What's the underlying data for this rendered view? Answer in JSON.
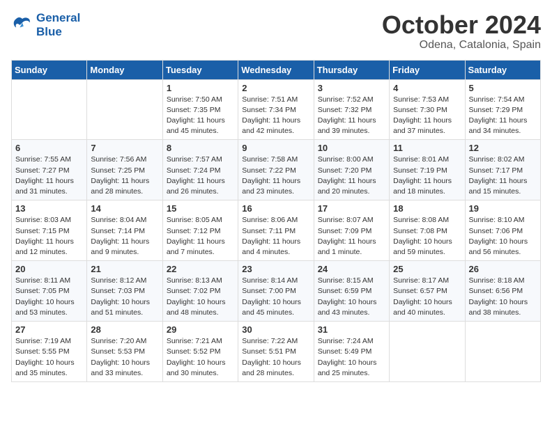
{
  "header": {
    "logo_line1": "General",
    "logo_line2": "Blue",
    "month": "October 2024",
    "location": "Odena, Catalonia, Spain"
  },
  "weekdays": [
    "Sunday",
    "Monday",
    "Tuesday",
    "Wednesday",
    "Thursday",
    "Friday",
    "Saturday"
  ],
  "weeks": [
    [
      {
        "day": null
      },
      {
        "day": null
      },
      {
        "day": 1,
        "sunrise": "Sunrise: 7:50 AM",
        "sunset": "Sunset: 7:35 PM",
        "daylight": "Daylight: 11 hours and 45 minutes."
      },
      {
        "day": 2,
        "sunrise": "Sunrise: 7:51 AM",
        "sunset": "Sunset: 7:34 PM",
        "daylight": "Daylight: 11 hours and 42 minutes."
      },
      {
        "day": 3,
        "sunrise": "Sunrise: 7:52 AM",
        "sunset": "Sunset: 7:32 PM",
        "daylight": "Daylight: 11 hours and 39 minutes."
      },
      {
        "day": 4,
        "sunrise": "Sunrise: 7:53 AM",
        "sunset": "Sunset: 7:30 PM",
        "daylight": "Daylight: 11 hours and 37 minutes."
      },
      {
        "day": 5,
        "sunrise": "Sunrise: 7:54 AM",
        "sunset": "Sunset: 7:29 PM",
        "daylight": "Daylight: 11 hours and 34 minutes."
      }
    ],
    [
      {
        "day": 6,
        "sunrise": "Sunrise: 7:55 AM",
        "sunset": "Sunset: 7:27 PM",
        "daylight": "Daylight: 11 hours and 31 minutes."
      },
      {
        "day": 7,
        "sunrise": "Sunrise: 7:56 AM",
        "sunset": "Sunset: 7:25 PM",
        "daylight": "Daylight: 11 hours and 28 minutes."
      },
      {
        "day": 8,
        "sunrise": "Sunrise: 7:57 AM",
        "sunset": "Sunset: 7:24 PM",
        "daylight": "Daylight: 11 hours and 26 minutes."
      },
      {
        "day": 9,
        "sunrise": "Sunrise: 7:58 AM",
        "sunset": "Sunset: 7:22 PM",
        "daylight": "Daylight: 11 hours and 23 minutes."
      },
      {
        "day": 10,
        "sunrise": "Sunrise: 8:00 AM",
        "sunset": "Sunset: 7:20 PM",
        "daylight": "Daylight: 11 hours and 20 minutes."
      },
      {
        "day": 11,
        "sunrise": "Sunrise: 8:01 AM",
        "sunset": "Sunset: 7:19 PM",
        "daylight": "Daylight: 11 hours and 18 minutes."
      },
      {
        "day": 12,
        "sunrise": "Sunrise: 8:02 AM",
        "sunset": "Sunset: 7:17 PM",
        "daylight": "Daylight: 11 hours and 15 minutes."
      }
    ],
    [
      {
        "day": 13,
        "sunrise": "Sunrise: 8:03 AM",
        "sunset": "Sunset: 7:15 PM",
        "daylight": "Daylight: 11 hours and 12 minutes."
      },
      {
        "day": 14,
        "sunrise": "Sunrise: 8:04 AM",
        "sunset": "Sunset: 7:14 PM",
        "daylight": "Daylight: 11 hours and 9 minutes."
      },
      {
        "day": 15,
        "sunrise": "Sunrise: 8:05 AM",
        "sunset": "Sunset: 7:12 PM",
        "daylight": "Daylight: 11 hours and 7 minutes."
      },
      {
        "day": 16,
        "sunrise": "Sunrise: 8:06 AM",
        "sunset": "Sunset: 7:11 PM",
        "daylight": "Daylight: 11 hours and 4 minutes."
      },
      {
        "day": 17,
        "sunrise": "Sunrise: 8:07 AM",
        "sunset": "Sunset: 7:09 PM",
        "daylight": "Daylight: 11 hours and 1 minute."
      },
      {
        "day": 18,
        "sunrise": "Sunrise: 8:08 AM",
        "sunset": "Sunset: 7:08 PM",
        "daylight": "Daylight: 10 hours and 59 minutes."
      },
      {
        "day": 19,
        "sunrise": "Sunrise: 8:10 AM",
        "sunset": "Sunset: 7:06 PM",
        "daylight": "Daylight: 10 hours and 56 minutes."
      }
    ],
    [
      {
        "day": 20,
        "sunrise": "Sunrise: 8:11 AM",
        "sunset": "Sunset: 7:05 PM",
        "daylight": "Daylight: 10 hours and 53 minutes."
      },
      {
        "day": 21,
        "sunrise": "Sunrise: 8:12 AM",
        "sunset": "Sunset: 7:03 PM",
        "daylight": "Daylight: 10 hours and 51 minutes."
      },
      {
        "day": 22,
        "sunrise": "Sunrise: 8:13 AM",
        "sunset": "Sunset: 7:02 PM",
        "daylight": "Daylight: 10 hours and 48 minutes."
      },
      {
        "day": 23,
        "sunrise": "Sunrise: 8:14 AM",
        "sunset": "Sunset: 7:00 PM",
        "daylight": "Daylight: 10 hours and 45 minutes."
      },
      {
        "day": 24,
        "sunrise": "Sunrise: 8:15 AM",
        "sunset": "Sunset: 6:59 PM",
        "daylight": "Daylight: 10 hours and 43 minutes."
      },
      {
        "day": 25,
        "sunrise": "Sunrise: 8:17 AM",
        "sunset": "Sunset: 6:57 PM",
        "daylight": "Daylight: 10 hours and 40 minutes."
      },
      {
        "day": 26,
        "sunrise": "Sunrise: 8:18 AM",
        "sunset": "Sunset: 6:56 PM",
        "daylight": "Daylight: 10 hours and 38 minutes."
      }
    ],
    [
      {
        "day": 27,
        "sunrise": "Sunrise: 7:19 AM",
        "sunset": "Sunset: 5:55 PM",
        "daylight": "Daylight: 10 hours and 35 minutes."
      },
      {
        "day": 28,
        "sunrise": "Sunrise: 7:20 AM",
        "sunset": "Sunset: 5:53 PM",
        "daylight": "Daylight: 10 hours and 33 minutes."
      },
      {
        "day": 29,
        "sunrise": "Sunrise: 7:21 AM",
        "sunset": "Sunset: 5:52 PM",
        "daylight": "Daylight: 10 hours and 30 minutes."
      },
      {
        "day": 30,
        "sunrise": "Sunrise: 7:22 AM",
        "sunset": "Sunset: 5:51 PM",
        "daylight": "Daylight: 10 hours and 28 minutes."
      },
      {
        "day": 31,
        "sunrise": "Sunrise: 7:24 AM",
        "sunset": "Sunset: 5:49 PM",
        "daylight": "Daylight: 10 hours and 25 minutes."
      },
      {
        "day": null
      },
      {
        "day": null
      }
    ]
  ]
}
